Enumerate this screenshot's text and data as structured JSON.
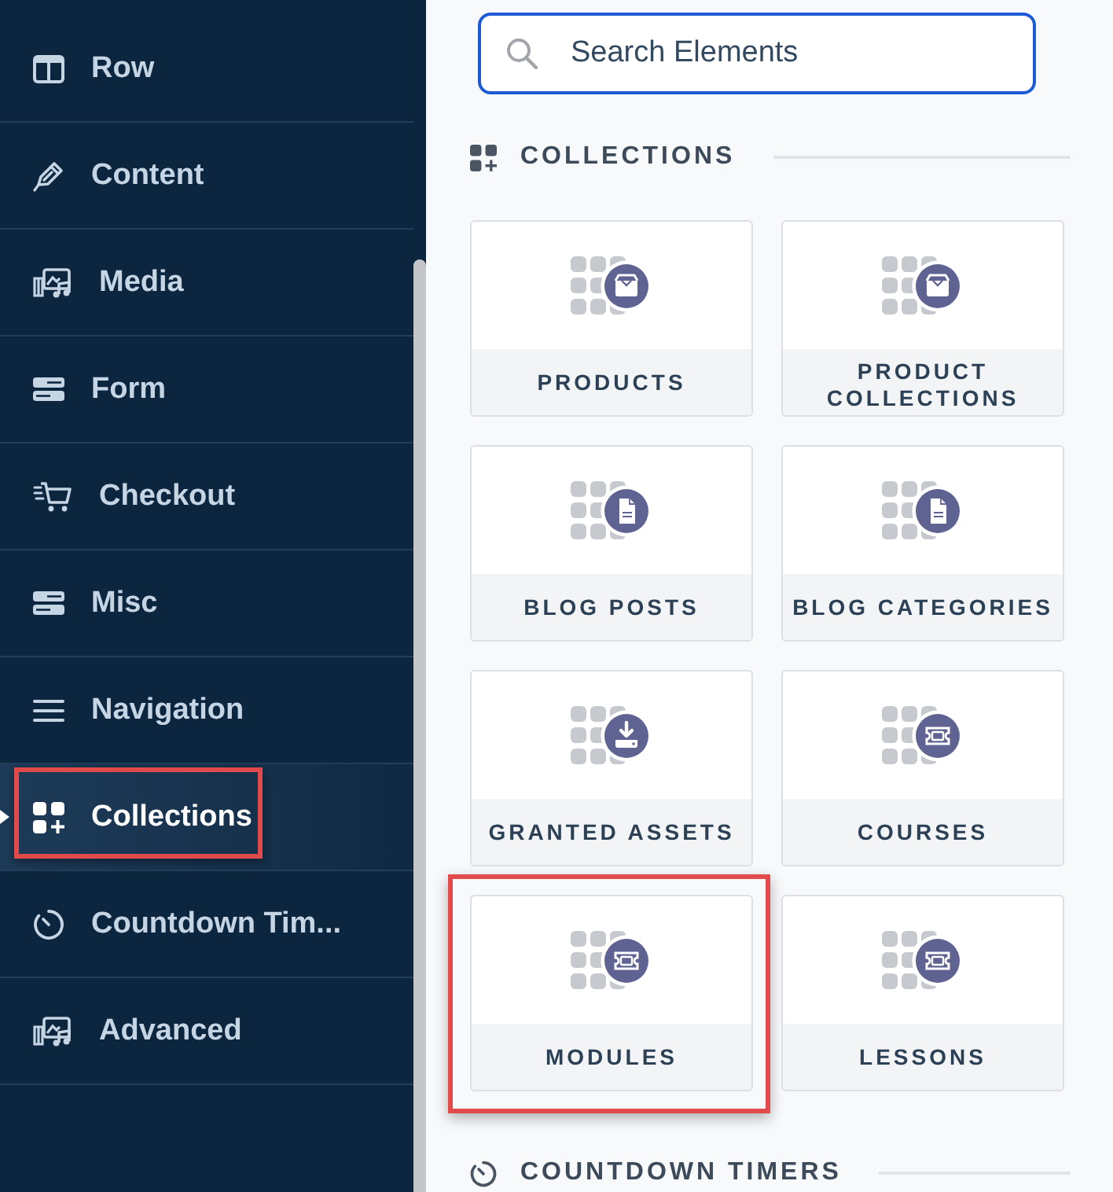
{
  "sidebar": {
    "items": [
      {
        "label": "Row",
        "selected": false,
        "highlighted": false
      },
      {
        "label": "Content",
        "selected": false,
        "highlighted": false
      },
      {
        "label": "Media",
        "selected": false,
        "highlighted": false
      },
      {
        "label": "Form",
        "selected": false,
        "highlighted": false
      },
      {
        "label": "Checkout",
        "selected": false,
        "highlighted": false
      },
      {
        "label": "Misc",
        "selected": false,
        "highlighted": false
      },
      {
        "label": "Navigation",
        "selected": false,
        "highlighted": false
      },
      {
        "label": "Collections",
        "selected": true,
        "highlighted": true
      },
      {
        "label": "Countdown Tim...",
        "selected": false,
        "highlighted": false
      },
      {
        "label": "Advanced",
        "selected": false,
        "highlighted": false
      }
    ]
  },
  "search": {
    "placeholder": "Search Elements"
  },
  "sections": [
    {
      "title": "COLLECTIONS",
      "cards": [
        {
          "label": "PRODUCTS",
          "highlighted": false
        },
        {
          "label": "PRODUCT COLLECTIONS",
          "highlighted": false
        },
        {
          "label": "BLOG POSTS",
          "highlighted": false
        },
        {
          "label": "BLOG CATEGORIES",
          "highlighted": false
        },
        {
          "label": "GRANTED ASSETS",
          "highlighted": false
        },
        {
          "label": "COURSES",
          "highlighted": false
        },
        {
          "label": "MODULES",
          "highlighted": true
        },
        {
          "label": "LESSONS",
          "highlighted": false
        }
      ]
    },
    {
      "title": "COUNTDOWN TIMERS"
    }
  ]
}
